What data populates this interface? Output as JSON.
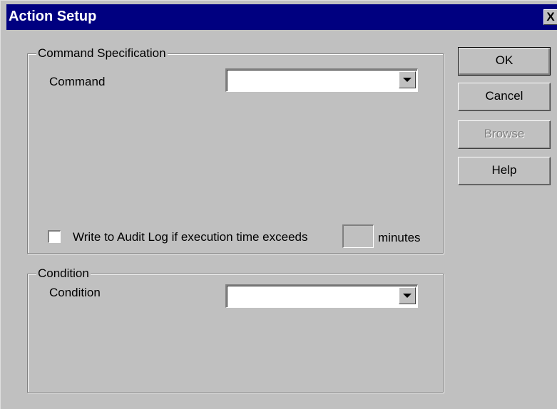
{
  "window": {
    "title": "Action Setup",
    "close_label": "X"
  },
  "command_group": {
    "title": "Command Specification",
    "command_label": "Command",
    "command_value": "",
    "audit_checkbox_checked": false,
    "audit_label": "Write to Audit Log if execution time exceeds",
    "audit_minutes_value": "",
    "minutes_label": "minutes"
  },
  "condition_group": {
    "title": "Condition",
    "condition_label": "Condition",
    "condition_value": ""
  },
  "buttons": {
    "ok": "OK",
    "cancel": "Cancel",
    "browse": "Browse",
    "help": "Help",
    "browse_enabled": false
  },
  "icons": {
    "dropdown": "chevron-down-icon",
    "close": "close-icon"
  }
}
